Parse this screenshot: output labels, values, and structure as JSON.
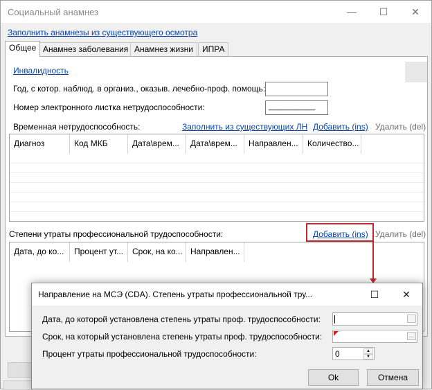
{
  "window": {
    "title": "Социальный анамнез",
    "minimize_glyph": "—",
    "maximize_glyph": "☐",
    "close_glyph": "✕"
  },
  "fill_from_exam_link": "Заполнить анамнезы из существующего осмотра",
  "tabs": [
    {
      "label": "Общее",
      "active": true
    },
    {
      "label": "Анамнез заболевания",
      "active": false
    },
    {
      "label": "Анамнез жизни",
      "active": false
    },
    {
      "label": "ИПРА",
      "active": false
    }
  ],
  "general": {
    "disability_link": "Инвалидность",
    "year_label": "Год, с котор. наблюд. в организ., оказыв. лечебно-проф. помощь:",
    "year_value": "",
    "sick_leave_label": "Номер электронного листка нетрудоспособности:",
    "sick_leave_value": "___________"
  },
  "temp_disability": {
    "label": "Временная нетрудоспособность:",
    "fill_link": "Заполнить из существующих ЛН",
    "add_link": "Добавить (ins)",
    "delete_link": "Удалить (del)",
    "columns": [
      "Диагноз",
      "Код МКБ",
      "Дата\\врем...",
      "Дата\\врем...",
      "Направлен...",
      "Количество..."
    ]
  },
  "prof_loss": {
    "label": "Степени утраты профессиональной трудоспособности:",
    "add_link": "Добавить (ins)",
    "delete_link": "Удалить (del)",
    "columns": [
      "Дата, до ко...",
      "Процент ут...",
      "Срок, на ко...",
      "Направлен..."
    ]
  },
  "dialog": {
    "title": "Направление на МСЭ (CDA). Степень утраты профессиональной тру...",
    "date_label": "Дата, до которой установлена степень утраты проф. трудоспособности:",
    "term_label": "Срок, на который установлена степень утраты проф. трудоспособности:",
    "percent_label": "Процент утраты профессиональной трудоспособности:",
    "percent_value": "0",
    "ok_label": "Ok",
    "cancel_label": "Отмена",
    "maximize_glyph": "☐",
    "close_glyph": "✕"
  },
  "colors": {
    "link": "#0645ad",
    "highlight": "#c0282e",
    "window_bg": "#f0f0f0"
  }
}
